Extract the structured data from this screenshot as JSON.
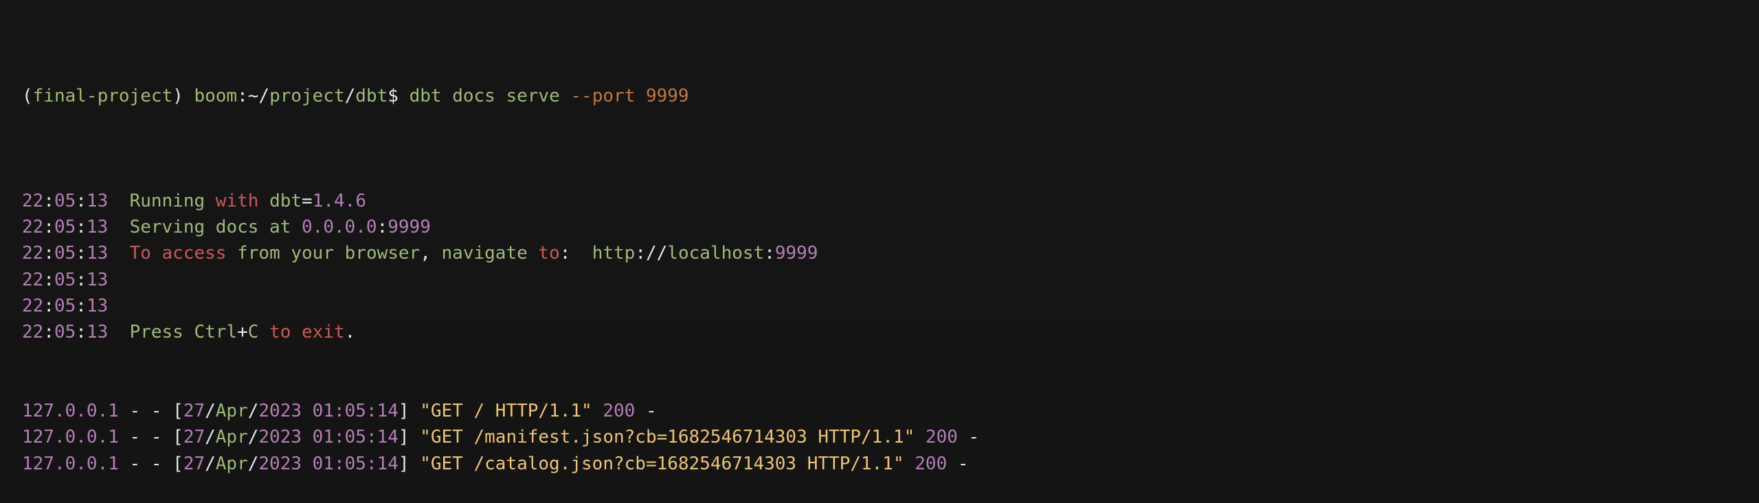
{
  "prompt": {
    "open_paren": "(",
    "env": "final-project",
    "close_paren": ")",
    "user": "boom",
    "colon": ":",
    "tilde": "~",
    "slash1": "/",
    "dir1": "project",
    "slash2": "/",
    "dir2": "dbt",
    "dollar": "$",
    "cmd": "dbt docs serve",
    "flag": "--port",
    "port": "9999"
  },
  "log_lines": [
    {
      "time": "22:05:13",
      "parts": [
        {
          "text": "Running",
          "color": "g"
        },
        {
          "text": " ",
          "color": "w"
        },
        {
          "text": "with",
          "color": "r"
        },
        {
          "text": " dbt",
          "color": "g"
        },
        {
          "text": "=",
          "color": "w"
        },
        {
          "text": "1.4.6",
          "color": "p"
        }
      ]
    },
    {
      "time": "22:05:13",
      "parts": [
        {
          "text": "Serving docs at ",
          "color": "g"
        },
        {
          "text": "0.0.0.0",
          "color": "p"
        },
        {
          "text": ":",
          "color": "w"
        },
        {
          "text": "9999",
          "color": "p"
        }
      ]
    },
    {
      "time": "22:05:13",
      "parts": [
        {
          "text": "To access",
          "color": "r"
        },
        {
          "text": " from your browser",
          "color": "g"
        },
        {
          "text": ",",
          "color": "w"
        },
        {
          "text": " navigate ",
          "color": "g"
        },
        {
          "text": "to",
          "color": "r"
        },
        {
          "text": ":  ",
          "color": "w"
        },
        {
          "text": "http",
          "color": "g"
        },
        {
          "text": "://",
          "color": "w"
        },
        {
          "text": "localhost",
          "color": "g"
        },
        {
          "text": ":",
          "color": "w"
        },
        {
          "text": "9999",
          "color": "p"
        }
      ]
    },
    {
      "time": "22:05:13",
      "parts": []
    },
    {
      "time": "22:05:13",
      "parts": []
    },
    {
      "time": "22:05:13",
      "parts": [
        {
          "text": "Press Ctrl",
          "color": "g"
        },
        {
          "text": "+",
          "color": "w"
        },
        {
          "text": "C",
          "color": "g"
        },
        {
          "text": " to exit",
          "color": "r"
        },
        {
          "text": ".",
          "color": "w"
        }
      ]
    }
  ],
  "http_lines": [
    {
      "ip": "127.0.0.1",
      "dashes": " - - [",
      "day": "27",
      "sep1": "/",
      "month": "Apr",
      "sep2": "/",
      "yeartime": "2023 01:05:14",
      "close": "]",
      "request": "\"GET / HTTP/1.1\"",
      "status": "200",
      "tail": " -"
    },
    {
      "ip": "127.0.0.1",
      "dashes": " - - [",
      "day": "27",
      "sep1": "/",
      "month": "Apr",
      "sep2": "/",
      "yeartime": "2023 01:05:14",
      "close": "]",
      "request": "\"GET /manifest.json?cb=1682546714303 HTTP/1.1\"",
      "status": "200",
      "tail": " -"
    },
    {
      "ip": "127.0.0.1",
      "dashes": " - - [",
      "day": "27",
      "sep1": "/",
      "month": "Apr",
      "sep2": "/",
      "yeartime": "2023 01:05:14",
      "close": "]",
      "request": "\"GET /catalog.json?cb=1682546714303 HTTP/1.1\"",
      "status": "200",
      "tail": " -"
    }
  ],
  "colors": {
    "background": "#151515",
    "default": "#e6e6e6",
    "green": "#9fba76",
    "purple": "#b57eb8",
    "red": "#cf5757",
    "orange": "#c0773e",
    "yellow": "#efc46e"
  }
}
